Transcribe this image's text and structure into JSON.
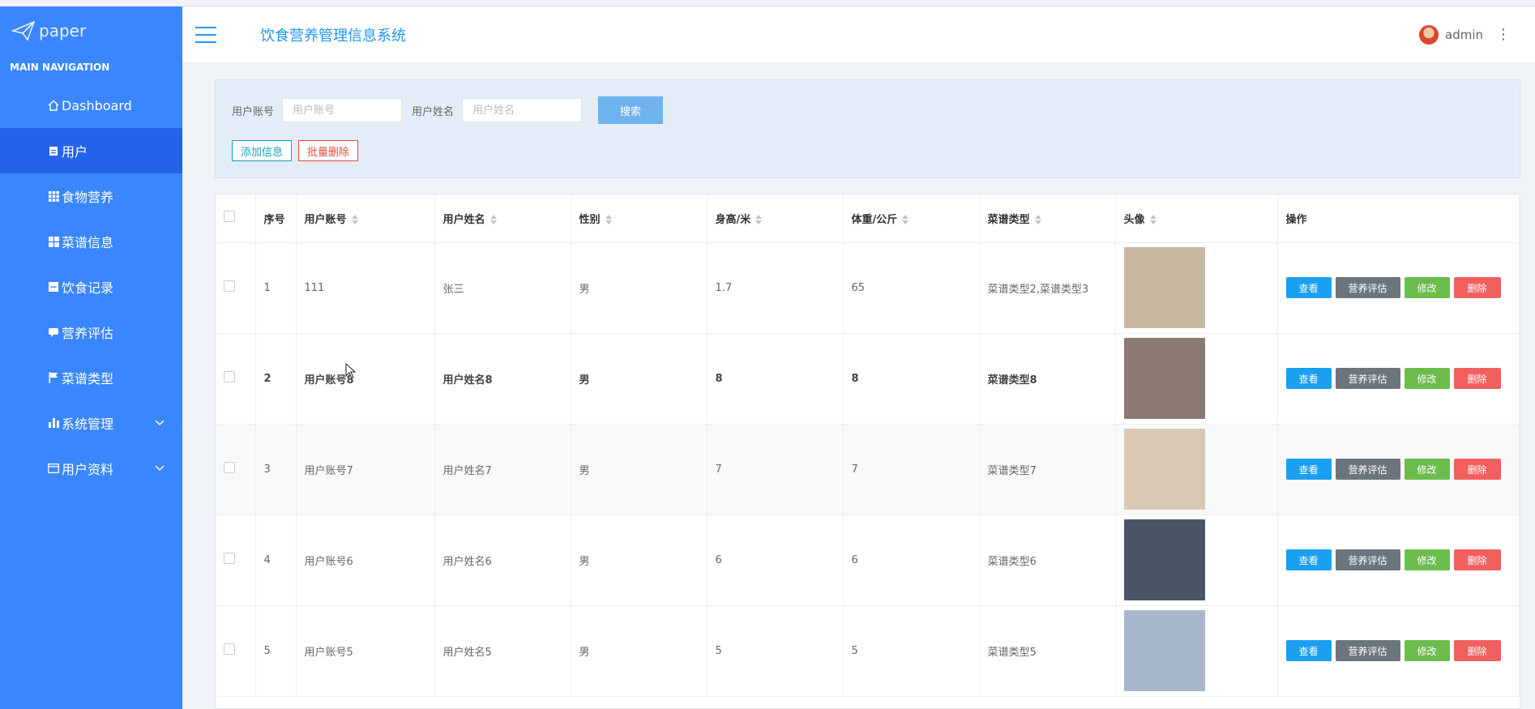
{
  "sidebar": {
    "logo_text": "paper",
    "nav_title": "MAIN NAVIGATION",
    "items": [
      {
        "label": "Dashboard",
        "icon": "home-icon"
      },
      {
        "label": "用户",
        "icon": "clipboard-icon"
      },
      {
        "label": "食物营养",
        "icon": "grid-icon"
      },
      {
        "label": "菜谱信息",
        "icon": "tiles-icon"
      },
      {
        "label": "饮食记录",
        "icon": "minus-square-icon"
      },
      {
        "label": "营养评估",
        "icon": "message-icon"
      },
      {
        "label": "菜谱类型",
        "icon": "flag-icon"
      },
      {
        "label": "系统管理",
        "icon": "bar-chart-icon"
      },
      {
        "label": "用户资料",
        "icon": "card-icon"
      }
    ]
  },
  "header": {
    "title": "饮食营养管理信息系统",
    "username": "admin"
  },
  "search": {
    "account_label": "用户账号",
    "account_placeholder": "用户账号",
    "name_label": "用户姓名",
    "name_placeholder": "用户姓名",
    "search_button": "搜索",
    "add_button": "添加信息",
    "batch_delete_button": "批量删除"
  },
  "table": {
    "columns": [
      "序号",
      "用户账号",
      "用户姓名",
      "性别",
      "身高/米",
      "体重/公斤",
      "菜谱类型",
      "头像",
      "操作"
    ],
    "actions": {
      "view": "查看",
      "evaluate": "营养评估",
      "edit": "修改",
      "delete": "删除"
    },
    "rows": [
      {
        "no": "1",
        "account": "111",
        "name": "张三",
        "gender": "男",
        "height": "1.7",
        "weight": "65",
        "recipe_type": "菜谱类型2,菜谱类型3",
        "avatar_color": "#c9b8a0"
      },
      {
        "no": "2",
        "account": "用户账号8",
        "name": "用户姓名8",
        "gender": "男",
        "height": "8",
        "weight": "8",
        "recipe_type": "菜谱类型8",
        "avatar_color": "#8a7a72"
      },
      {
        "no": "3",
        "account": "用户账号7",
        "name": "用户姓名7",
        "gender": "男",
        "height": "7",
        "weight": "7",
        "recipe_type": "菜谱类型7",
        "avatar_color": "#d9c9b4"
      },
      {
        "no": "4",
        "account": "用户账号6",
        "name": "用户姓名6",
        "gender": "男",
        "height": "6",
        "weight": "6",
        "recipe_type": "菜谱类型6",
        "avatar_color": "#4a5568"
      },
      {
        "no": "5",
        "account": "用户账号5",
        "name": "用户姓名5",
        "gender": "男",
        "height": "5",
        "weight": "5",
        "recipe_type": "菜谱类型5",
        "avatar_color": "#a9b7cc"
      }
    ]
  },
  "colors": {
    "sidebar": "#3a86ff",
    "sidebar_active": "#2563eb",
    "accent": "#2196f3"
  }
}
